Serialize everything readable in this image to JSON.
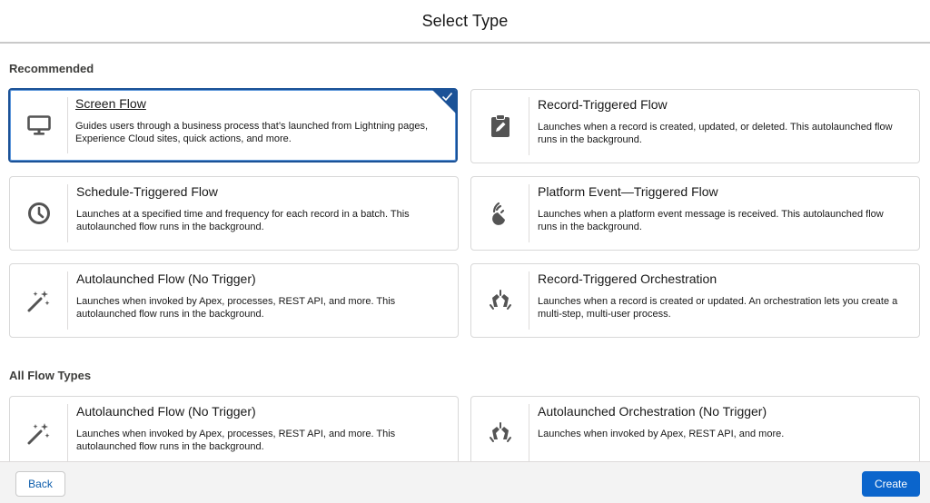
{
  "header": {
    "title": "Select Type"
  },
  "sections": {
    "recommended": "Recommended",
    "all_flow_types": "All Flow Types"
  },
  "recommended_cards": [
    {
      "title": "Screen Flow",
      "desc": "Guides users through a business process that’s launched from Lightning pages, Experience Cloud sites, quick actions, and more.",
      "icon": "monitor-icon",
      "selected": true
    },
    {
      "title": "Record-Triggered Flow",
      "desc": "Launches when a record is created, updated, or deleted. This autolaunched flow runs in the background.",
      "icon": "clipboard-edit-icon",
      "selected": false
    },
    {
      "title": "Schedule-Triggered Flow",
      "desc": "Launches at a specified time and frequency for each record in a batch. This autolaunched flow runs in the background.",
      "icon": "clock-icon",
      "selected": false
    },
    {
      "title": "Platform Event—Triggered Flow",
      "desc": "Launches when a platform event message is received. This autolaunched flow runs in the background.",
      "icon": "broadcast-icon",
      "selected": false
    },
    {
      "title": "Autolaunched Flow (No Trigger)",
      "desc": "Launches when invoked by Apex, processes, REST API, and more. This autolaunched flow runs in the background.",
      "icon": "magic-wand-icon",
      "selected": false
    },
    {
      "title": "Record-Triggered Orchestration",
      "desc": "Launches when a record is created or updated. An orchestration lets you create a multi-step, multi-user process.",
      "icon": "orchestration-icon",
      "selected": false
    }
  ],
  "all_cards": [
    {
      "title": "Autolaunched Flow (No Trigger)",
      "desc": "Launches when invoked by Apex, processes, REST API, and more. This autolaunched flow runs in the background.",
      "icon": "magic-wand-icon"
    },
    {
      "title": "Autolaunched Orchestration (No Trigger)",
      "desc": "Launches when invoked by Apex, REST API, and more.",
      "icon": "orchestration-icon"
    }
  ],
  "footer": {
    "back_label": "Back",
    "create_label": "Create"
  },
  "colors": {
    "accent": "#0b65cc",
    "selected_border": "#1b5297",
    "icon": "#545454"
  }
}
